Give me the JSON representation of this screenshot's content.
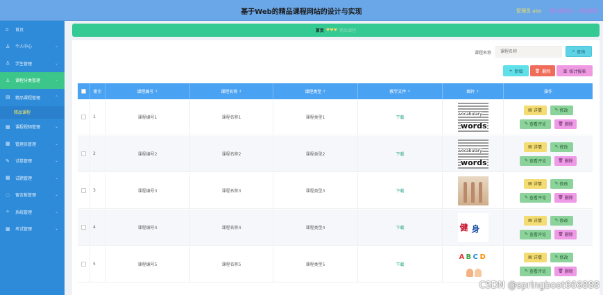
{
  "header": {
    "title": "基于Web的精品课程网站的设计与实现",
    "admin_text": "管理员 abo",
    "link1": "退出到前台",
    "link2": "退出登录"
  },
  "sidebar": {
    "items": [
      {
        "label": "首页",
        "icon": "home-icon"
      },
      {
        "label": "个人中心",
        "icon": "user-icon"
      },
      {
        "label": "学生管理",
        "icon": "user-icon"
      },
      {
        "label": "课程分类管理",
        "icon": "user-icon"
      },
      {
        "label": "精品课程管理",
        "icon": "book-icon"
      },
      {
        "label": "课程视频管理",
        "icon": "grid-icon"
      },
      {
        "label": "管理员管理",
        "icon": "grid-icon"
      },
      {
        "label": "试卷管理",
        "icon": "edit-icon"
      },
      {
        "label": "试题管理",
        "icon": "grid-icon"
      },
      {
        "label": "留言板管理",
        "icon": "comment-icon"
      },
      {
        "label": "系统管理",
        "icon": "settings-icon"
      },
      {
        "label": "考试管理",
        "icon": "grid-icon"
      }
    ],
    "sub_item": "精品课程"
  },
  "breadcrumb": {
    "home": "首页",
    "current": "精品课程"
  },
  "search": {
    "label": "课程名称",
    "placeholder": "课程名称",
    "button": "查询"
  },
  "actions": {
    "add": "新增",
    "delete": "删除",
    "stats": "统计报表"
  },
  "table": {
    "columns": [
      "索引",
      "课程编号",
      "课程名称",
      "课程类型",
      "教学文件",
      "图片",
      "操作"
    ],
    "rows": [
      {
        "index": "1",
        "code": "课程编号1",
        "name": "课程名称1",
        "type": "课程类型1",
        "file": "下载",
        "image": "words"
      },
      {
        "index": "2",
        "code": "课程编号2",
        "name": "课程名称2",
        "type": "课程类型2",
        "file": "下载",
        "image": "words"
      },
      {
        "index": "3",
        "code": "课程编号3",
        "name": "课程名称3",
        "type": "课程类型3",
        "file": "下载",
        "image": "ballet"
      },
      {
        "index": "4",
        "code": "课程编号4",
        "name": "课程名称4",
        "type": "课程类型4",
        "file": "下载",
        "image": "fitness"
      },
      {
        "index": "5",
        "code": "课程编号5",
        "name": "课程名称5",
        "type": "课程类型5",
        "file": "下载",
        "image": "abcd"
      }
    ],
    "row_actions": {
      "detail": "详情",
      "edit": "修改",
      "comments": "查看评论",
      "delete": "删除"
    }
  },
  "watermark": "CSDN @springboot666888",
  "colors": {
    "header": "#6aa7e8",
    "sidebar": "#2e8bd9",
    "active": "#3cc68a",
    "table_head": "#4aa2f2"
  }
}
